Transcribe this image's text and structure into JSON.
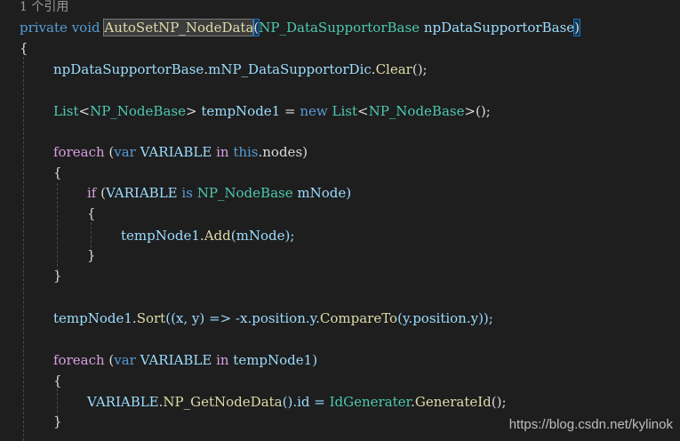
{
  "codelens": "1 个引用",
  "signature": {
    "private": "private",
    "void": "void",
    "method": "AutoSetNP_NodeData",
    "open": "(",
    "type": "NP_DataSupportorBase",
    "param": "npDataSupportorBase",
    "close": ")"
  },
  "lines": {
    "brace_open": "{",
    "l1_obj": "npDataSupportorBase",
    "l1_dot": ".",
    "l1_field": "mNP_DataSupportorDic",
    "l1_dot2": ".",
    "l1_call": "Clear",
    "l1_end": "();",
    "l2_list": "List",
    "l2_lt": "<",
    "l2_type": "NP_NodeBase",
    "l2_gt": ">",
    "l2_var": " tempNode1 ",
    "l2_eq": "= ",
    "l2_new": "new",
    "l2_sp": " ",
    "l2_list2": "List",
    "l2_lt2": "<",
    "l2_type2": "NP_NodeBase",
    "l2_end": ">();",
    "f1_foreach": "foreach",
    "f1_open": " (",
    "f1_var": "var",
    "f1_sp": " ",
    "f1_name": "VARIABLE",
    "f1_sp2": " ",
    "f1_in": "in",
    "f1_sp3": " ",
    "f1_this": "this",
    "f1_rest": ".nodes)",
    "f1_brace": "{",
    "if_kw": "if",
    "if_open": " (",
    "if_name": "VARIABLE",
    "if_sp": " ",
    "if_is": "is",
    "if_sp2": " ",
    "if_type": "NP_NodeBase",
    "if_rest": " mNode)",
    "if_brace": "{",
    "add_obj": "tempNode1",
    "add_dot": ".",
    "add_call": "Add",
    "add_rest": "(mNode);",
    "if_brace_close": "}",
    "f1_brace_close": "}",
    "sort_obj": "tempNode1",
    "sort_dot": ".",
    "sort_call": "Sort",
    "sort_mid": "((x, y) => -x.position.y.",
    "sort_cmp": "CompareTo",
    "sort_end": "(y.position.y));",
    "f2_foreach": "foreach",
    "f2_open": " (",
    "f2_var": "var",
    "f2_sp": " ",
    "f2_name": "VARIABLE",
    "f2_sp2": " ",
    "f2_in": "in",
    "f2_rest": " tempNode1)",
    "f2_brace": "{",
    "gen_name": "VARIABLE",
    "gen_dot": ".",
    "gen_call": "NP_GetNodeData",
    "gen_mid": "().id = ",
    "gen_type": "IdGenerater",
    "gen_dot2": ".",
    "gen_call2": "GenerateId",
    "gen_end": "();",
    "f2_brace_close": "}"
  },
  "watermark": "https://blog.csdn.net/kylinok"
}
